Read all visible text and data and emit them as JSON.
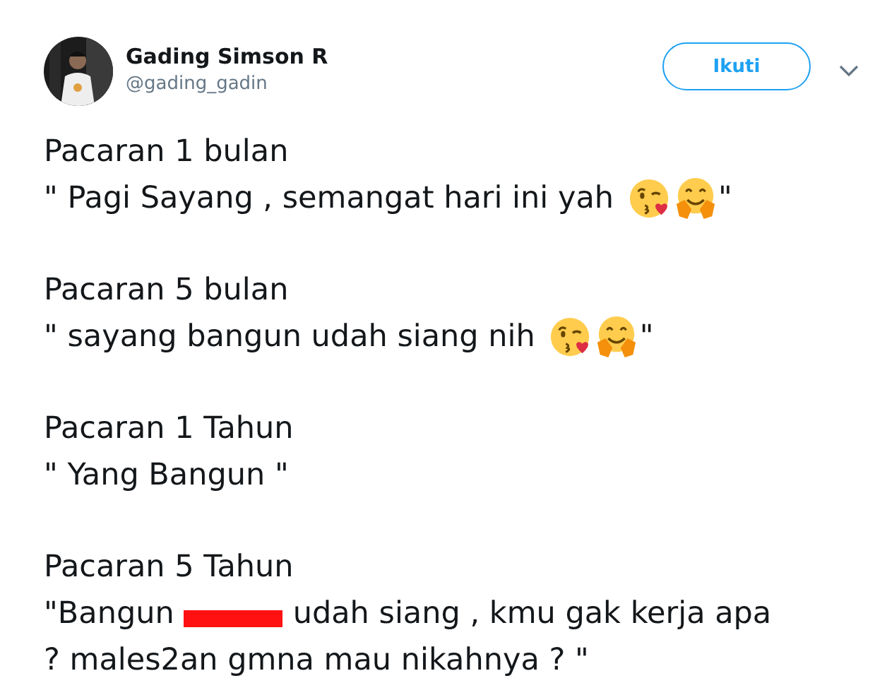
{
  "author": {
    "name": "Gading Simson R",
    "handle": "@gading_gadin"
  },
  "follow_button": {
    "label": "Ikuti"
  },
  "tweet": [
    {
      "lines": [
        [
          {
            "kind": "text",
            "text": "Pacaran 1 bulan"
          }
        ],
        [
          {
            "kind": "text",
            "text": "\" Pagi Sayang , semangat hari ini yah"
          },
          {
            "kind": "kiss_emoji"
          },
          {
            "kind": "hug_emoji"
          },
          {
            "kind": "text",
            "text": "\""
          }
        ]
      ]
    },
    {
      "lines": [
        [
          {
            "kind": "text",
            "text": "Pacaran 5 bulan"
          }
        ],
        [
          {
            "kind": "text",
            "text": "\" sayang bangun udah siang nih"
          },
          {
            "kind": "kiss_emoji"
          },
          {
            "kind": "hug_emoji"
          },
          {
            "kind": "text",
            "text": "\""
          }
        ]
      ]
    },
    {
      "lines": [
        [
          {
            "kind": "text",
            "text": "Pacaran 1 Tahun"
          }
        ],
        [
          {
            "kind": "text",
            "text": "\" Yang Bangun \""
          }
        ]
      ]
    },
    {
      "lines": [
        [
          {
            "kind": "text",
            "text": "Pacaran 5 Tahun"
          }
        ],
        [
          {
            "kind": "text",
            "text": "\"Bangun"
          },
          {
            "kind": "censor"
          },
          {
            "kind": "text",
            "text": "udah siang , kmu gak kerja apa"
          }
        ],
        [
          {
            "kind": "text",
            "text": "? males2an gmna mau nikahnya ? \""
          }
        ]
      ]
    }
  ]
}
